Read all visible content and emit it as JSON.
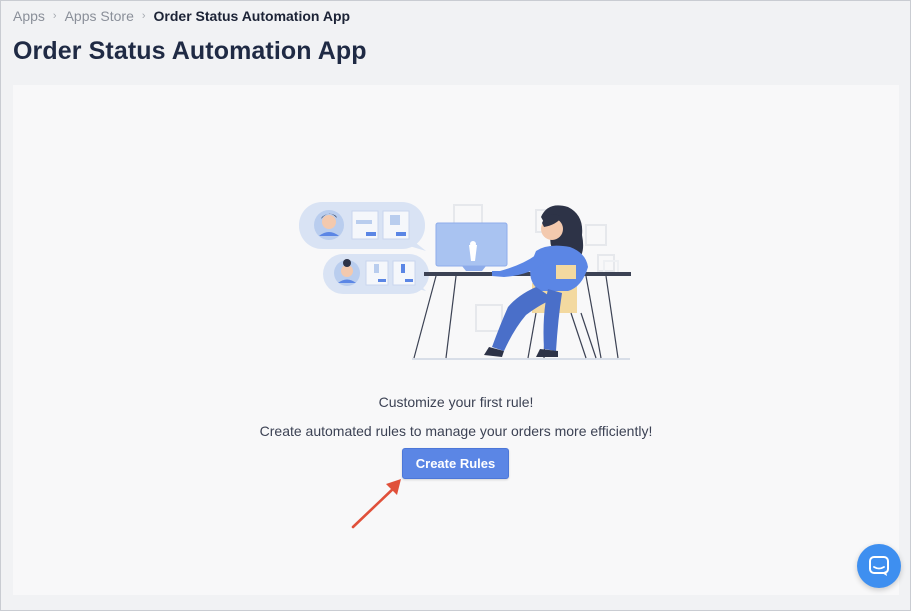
{
  "breadcrumb": {
    "items": [
      "Apps",
      "Apps Store",
      "Order Status Automation App"
    ]
  },
  "page": {
    "title": "Order Status Automation App"
  },
  "empty_state": {
    "heading": "Customize your first rule!",
    "description": "Create automated rules to manage your orders more efficiently!",
    "button_label": "Create Rules",
    "illustration": "person-at-computer-illustration"
  },
  "chat": {
    "icon": "chat-bubble-icon"
  },
  "colors": {
    "accent": "#5b86e5",
    "chat_launcher": "#3e8ff0",
    "arrow": "#e0503a"
  }
}
